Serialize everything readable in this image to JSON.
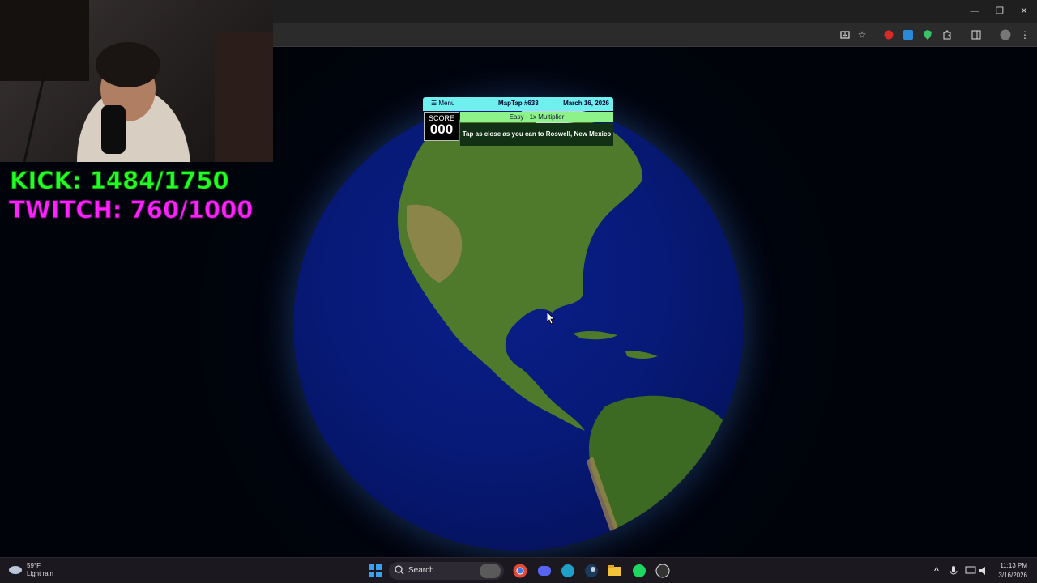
{
  "browser": {
    "window_controls": {
      "minimize": "—",
      "maximize": "❐",
      "close": "✕"
    },
    "toolbar_icons": [
      "install-icon",
      "bookmark-star-icon",
      "extension-red-icon",
      "extension-translate-icon",
      "extension-shield-icon",
      "extensions-puzzle-icon",
      "side-panel-icon",
      "profile-icon",
      "more-menu-icon"
    ]
  },
  "overlay": {
    "kick_goal": "KICK: 1484/1750",
    "twitch_goal": "TWITCH: 760/1000"
  },
  "game": {
    "menu_label": "☰ Menu",
    "title": "MapTap #633",
    "date": "March 16, 2026",
    "score_label": "SCORE",
    "score_value": "000",
    "difficulty": "Easy - 1x Multiplier",
    "prompt": "Tap as close as you can to Roswell, New Mexico",
    "colors": {
      "header": "#6ff0ee",
      "difficulty": "#8ef28a",
      "prompt_bg": "#123014"
    }
  },
  "taskbar": {
    "weather_temp": "59°F",
    "weather_desc": "Light rain",
    "search_label": "Search",
    "time": "11:13 PM",
    "date": "3/16/2026",
    "apps": [
      "windows-start-icon",
      "search-icon",
      "chrome-icon",
      "discord-icon",
      "edge-icon",
      "steam-icon",
      "file-explorer-icon",
      "spotify-icon",
      "obs-icon"
    ]
  }
}
